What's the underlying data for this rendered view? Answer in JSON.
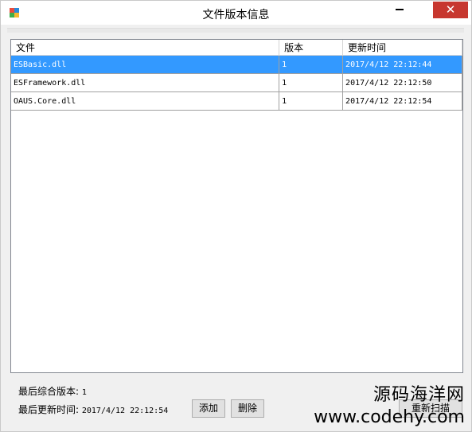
{
  "window": {
    "title": "文件版本信息",
    "close_glyph": "✕"
  },
  "table": {
    "columns": [
      "文件",
      "版本",
      "更新时间"
    ],
    "rows": [
      {
        "file": "ESBasic.dll",
        "version": "1",
        "time": "2017/4/12 22:12:44",
        "selected": true
      },
      {
        "file": "ESFramework.dll",
        "version": "1",
        "time": "2017/4/12 22:12:50",
        "selected": false
      },
      {
        "file": "OAUS.Core.dll",
        "version": "1",
        "time": "2017/4/12 22:12:54",
        "selected": false
      }
    ]
  },
  "info": {
    "latest_version_label": "最后综合版本:",
    "latest_version_value": "1",
    "last_update_label": "最后更新时间:",
    "last_update_value": "2017/4/12 22:12:54"
  },
  "buttons": {
    "add": "添加",
    "delete": "删除",
    "rescan": "重新扫描"
  },
  "watermark": {
    "line1": "源码海洋网",
    "line2": "www.codehy.com"
  },
  "colors": {
    "selection": "#3399ff",
    "close": "#c7372f"
  }
}
